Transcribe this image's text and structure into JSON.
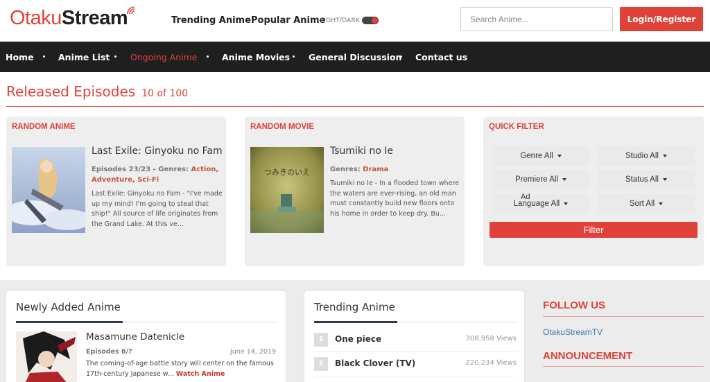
{
  "header": {
    "logo_part1": "Otaku",
    "logo_part2": "Stream",
    "links": [
      "Trending Anime",
      "Popular Anime"
    ],
    "toggle_label": "LIGHT/DARK",
    "search_placeholder": "Search Anime...",
    "login_label": "Login/Register"
  },
  "nav": {
    "items": [
      "Home",
      "Anime List",
      "Ongoing Anime",
      "Anime Movies",
      "General Discussion",
      "Contact us"
    ],
    "active": "Ongoing Anime"
  },
  "released": {
    "title": "Released Episodes",
    "count": "10 of 100"
  },
  "random_anime": {
    "heading": "RANDOM ANIME",
    "title": "Last Exile: Ginyoku no Fam",
    "episodes": "Episodes 23/23",
    "genres_label": "Genres:",
    "genres_line1": "Action,",
    "genres_line2": "Adventure, Sci-Fi",
    "description": "Last Exile: Ginyoku no Fam - \"I've made up my mind! I'm going to steal that ship!\" All source of life originates from the Grand Lake. At this ve..."
  },
  "random_movie": {
    "heading": "RANDOM MOVIE",
    "title": "Tsumiki no Ie",
    "genres_label": "Genres:",
    "genres": "Drama",
    "description": "Tsumiki no Ie - In a flooded town where the waters are ever-rising, an old man must constantly build new floors onto his home in order to keep dry. Bu...",
    "poster_text": "つみきのいえ"
  },
  "quick_filter": {
    "heading": "QUICK FILTER",
    "buttons": [
      "Genre All",
      "Studio All",
      "Premiere All",
      "Status All",
      "Language All",
      "Sort All"
    ],
    "ad_label": "Ad",
    "filter_label": "Filter"
  },
  "newly_added": {
    "heading": "Newly Added Anime",
    "title": "Masamune Datenicle",
    "episodes": "Episodes 6/?",
    "date": "June 14, 2019",
    "description": "The coming-of-age battle story will center on the famous 17th-century Japanese w...",
    "watch_label": "Watch Anime"
  },
  "trending": {
    "heading": "Trending Anime",
    "items": [
      {
        "rank": "1",
        "name": "One piece",
        "views": "308,958 Views"
      },
      {
        "rank": "2",
        "name": "Black Clover (TV)",
        "views": "220,234 Views"
      }
    ]
  },
  "sidebar": {
    "follow_heading": "FOLLOW US",
    "follow_link": "OtakuStreamTV",
    "announcement_heading": "ANNOUNCEMENT"
  },
  "colors": {
    "accent": "#e0423a",
    "navbar": "#1f1f1f",
    "panel": "#eeeeee"
  }
}
